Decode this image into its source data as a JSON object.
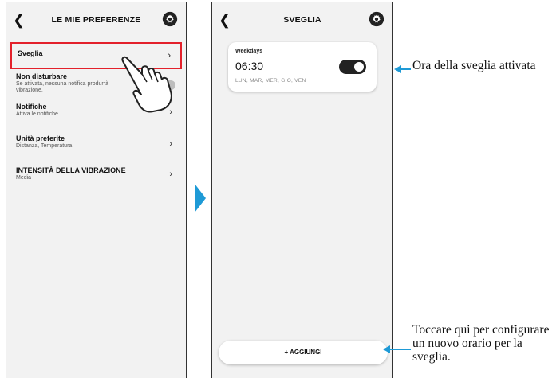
{
  "left_screen": {
    "title": "LE MIE PREFERENZE",
    "back_icon": "chevron-left-icon",
    "settings_icon": "gear-icon",
    "items": [
      {
        "title": "Sveglia",
        "subtitle": "",
        "control": "chevron",
        "highlighted": true
      },
      {
        "title": "Non disturbare",
        "subtitle": "Se attivata, nessuna notifica produrrà vibrazione.",
        "control": "toggle-off"
      },
      {
        "title": "Notifiche",
        "subtitle": "Attiva le notifiche",
        "control": "chevron"
      },
      {
        "title": "Unità preferite",
        "subtitle": "Distanza, Temperatura",
        "control": "chevron"
      },
      {
        "title": "INTENSITÀ DELLA VIBRAZIONE",
        "subtitle": "Media",
        "control": "chevron"
      }
    ],
    "chevron_glyph": "›",
    "highlight_color": "#e3212b"
  },
  "right_screen": {
    "title": "SVEGLIA",
    "back_icon": "chevron-left-icon",
    "settings_icon": "gear-icon",
    "alarm": {
      "label": "Weekdays",
      "time": "06:30",
      "days": "LUN, MAR, MER, GIO, VEN",
      "enabled": true
    },
    "add_button_label": "+ AGGIUNGI"
  },
  "callouts": {
    "alarm_on": "Ora della sveglia attivata",
    "add_hint": "Toccare qui per configurare un nuovo orario per la sveglia."
  },
  "accent_color": "#1e9ad6"
}
